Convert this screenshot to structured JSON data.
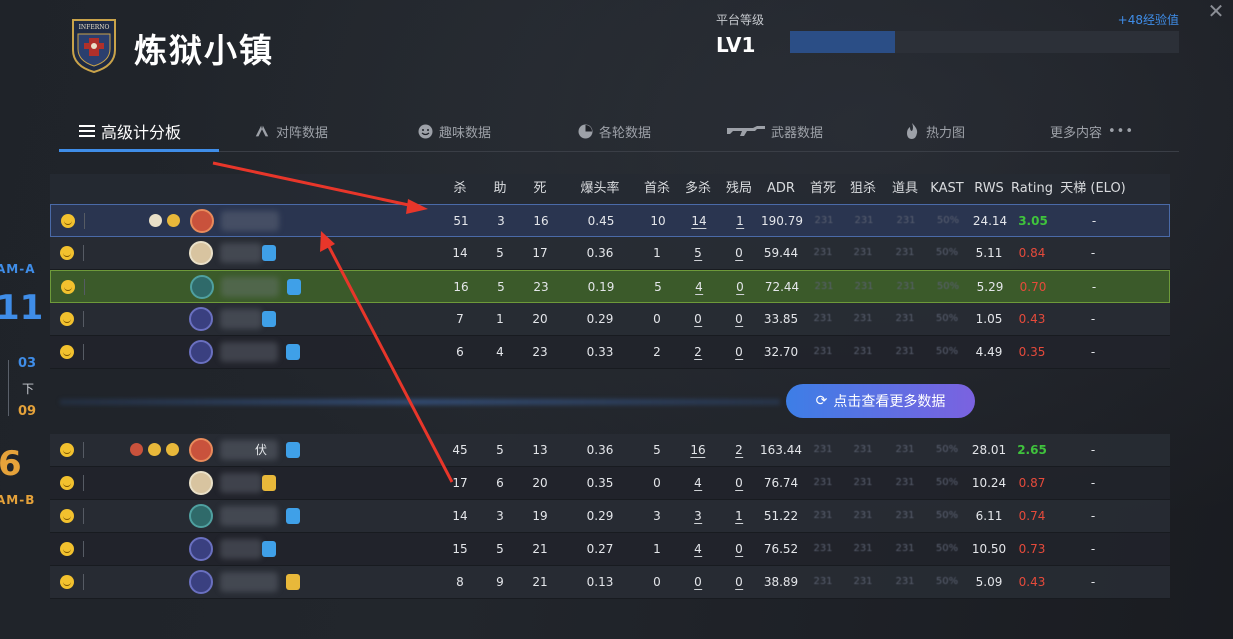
{
  "header": {
    "map_title": "炼狱小镇",
    "logo_text": "INFERNO",
    "level_label": "平台等级",
    "level_value": "LV1",
    "exp_gain": "+48经验值",
    "exp_progress": 0.27
  },
  "side": {
    "team_a": "AM-A",
    "score_a": "11",
    "round1": "03",
    "half_label": "下",
    "round2": "09",
    "score_b": "6",
    "team_b": "AM-B"
  },
  "tabs": [
    {
      "label": "高级计分板",
      "icon": "menu-icon",
      "active": true
    },
    {
      "label": "对阵数据",
      "icon": "versus-icon",
      "active": false
    },
    {
      "label": "趣味数据",
      "icon": "smile-icon",
      "active": false
    },
    {
      "label": "各轮数据",
      "icon": "pie-icon",
      "active": false
    },
    {
      "label": "武器数据",
      "icon": "rifle-icon",
      "active": false
    },
    {
      "label": "热力图",
      "icon": "flame-icon",
      "active": false
    },
    {
      "label": "更多内容",
      "icon": "more-dots-icon",
      "active": false
    }
  ],
  "columns": [
    "杀",
    "助",
    "死",
    "爆头率",
    "首杀",
    "多杀",
    "残局",
    "ADR",
    "首死",
    "狙杀",
    "道具",
    "KAST",
    "RWS",
    "Rating",
    "天梯 (ELO)"
  ],
  "blur_placeholder": "231",
  "blur_kast": "50%",
  "team_a_rows": [
    {
      "kills": "51",
      "assists": "3",
      "deaths": "16",
      "hs": "0.45",
      "fk": "10",
      "mk": "14",
      "clutch": "1",
      "adr": "190.79",
      "rws": "24.14",
      "rating": "3.05",
      "rating_good": true,
      "elo": "-"
    },
    {
      "kills": "14",
      "assists": "5",
      "deaths": "17",
      "hs": "0.36",
      "fk": "1",
      "mk": "5",
      "clutch": "0",
      "adr": "59.44",
      "rws": "5.11",
      "rating": "0.84",
      "rating_good": false,
      "elo": "-"
    },
    {
      "kills": "16",
      "assists": "5",
      "deaths": "23",
      "hs": "0.19",
      "fk": "5",
      "mk": "4",
      "clutch": "0",
      "adr": "72.44",
      "rws": "5.29",
      "rating": "0.70",
      "rating_good": false,
      "elo": "-"
    },
    {
      "kills": "7",
      "assists": "1",
      "deaths": "20",
      "hs": "0.29",
      "fk": "0",
      "mk": "0",
      "clutch": "0",
      "adr": "33.85",
      "rws": "1.05",
      "rating": "0.43",
      "rating_good": false,
      "elo": "-"
    },
    {
      "kills": "6",
      "assists": "4",
      "deaths": "23",
      "hs": "0.33",
      "fk": "2",
      "mk": "2",
      "clutch": "0",
      "adr": "32.70",
      "rws": "4.49",
      "rating": "0.35",
      "rating_good": false,
      "elo": "-"
    }
  ],
  "team_b_rows": [
    {
      "kills": "45",
      "assists": "5",
      "deaths": "13",
      "hs": "0.36",
      "fk": "5",
      "mk": "16",
      "clutch": "2",
      "adr": "163.44",
      "rws": "28.01",
      "rating": "2.65",
      "rating_good": true,
      "elo": "-",
      "name_suffix": "伏"
    },
    {
      "kills": "17",
      "assists": "6",
      "deaths": "20",
      "hs": "0.35",
      "fk": "0",
      "mk": "4",
      "clutch": "0",
      "adr": "76.74",
      "rws": "10.24",
      "rating": "0.87",
      "rating_good": false,
      "elo": "-"
    },
    {
      "kills": "14",
      "assists": "3",
      "deaths": "19",
      "hs": "0.29",
      "fk": "3",
      "mk": "3",
      "clutch": "1",
      "adr": "51.22",
      "rws": "6.11",
      "rating": "0.74",
      "rating_good": false,
      "elo": "-"
    },
    {
      "kills": "15",
      "assists": "5",
      "deaths": "21",
      "hs": "0.27",
      "fk": "1",
      "mk": "4",
      "clutch": "0",
      "adr": "76.52",
      "rws": "10.50",
      "rating": "0.73",
      "rating_good": false,
      "elo": "-"
    },
    {
      "kills": "8",
      "assists": "9",
      "deaths": "21",
      "hs": "0.13",
      "fk": "0",
      "mk": "0",
      "clutch": "0",
      "adr": "38.89",
      "rws": "5.09",
      "rating": "0.43",
      "rating_good": false,
      "elo": "-"
    }
  ],
  "more_button": "点击查看更多数据",
  "colors": {
    "accent_blue": "#3f8de8",
    "team_b_gold": "#e5a23a",
    "rating_good": "#3fc33c",
    "rating_bad": "#e54a3b",
    "annotation_arrow": "#e8362a"
  }
}
